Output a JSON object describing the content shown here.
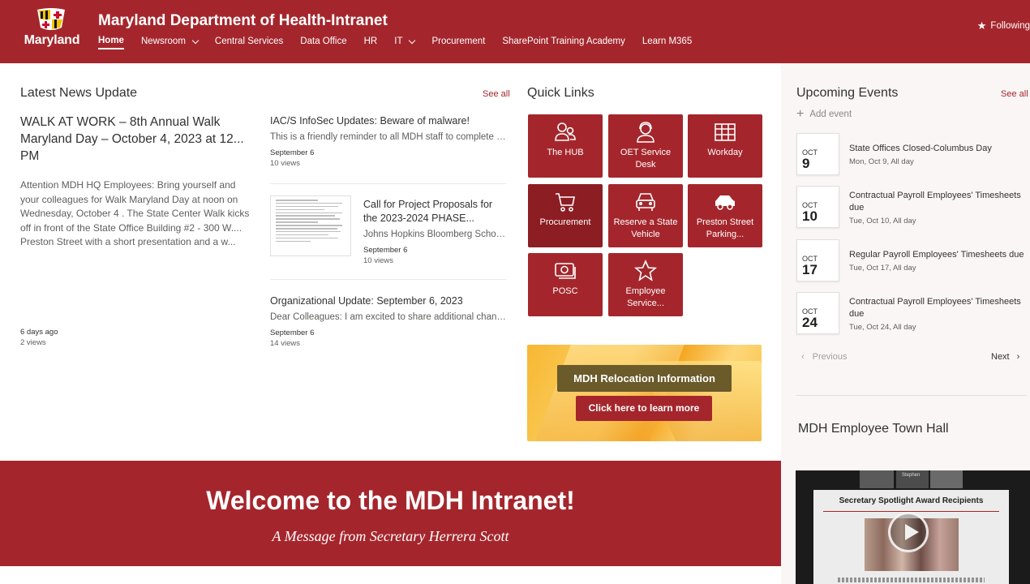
{
  "header": {
    "logo_text": "Maryland",
    "site_title": "Maryland Department of Health-Intranet",
    "following_label": "Following",
    "nav": [
      {
        "label": "Home"
      },
      {
        "label": "Newsroom"
      },
      {
        "label": "Central Services"
      },
      {
        "label": "Data Office"
      },
      {
        "label": "HR"
      },
      {
        "label": "IT"
      },
      {
        "label": "Procurement"
      },
      {
        "label": "SharePoint Training Academy"
      },
      {
        "label": "Learn M365"
      }
    ]
  },
  "news": {
    "title": "Latest News Update",
    "see_all": "See all",
    "featured": {
      "title": "WALK AT WORK – 8th Annual Walk Maryland Day – October 4, 2023 at 12... PM",
      "description": "Attention MDH HQ Employees: Bring yourself and your colleagues for Walk Maryland Day at noon on Wednesday, October 4 . The State Center Walk kicks off in front of the State Office Building #2 - 300 W.... Preston Street with a short presentation and a w...",
      "date": "6 days ago",
      "views": "2 views"
    },
    "items": [
      {
        "title": "IAC/S InfoSec Updates: Beware of malware!",
        "description": "This is a friendly reminder to all MDH staff to complete you...",
        "date": "September 6",
        "views": "10 views"
      },
      {
        "title": "Call for Project Proposals for the 2023-2024 PHASE...",
        "description": "Johns Hopkins Bloomberg School ...",
        "date": "September 6",
        "views": "10 views"
      },
      {
        "title": "Organizational Update: September 6, 2023",
        "description": "Dear Colleagues: I am excited to share additional changes i...",
        "date": "September 6",
        "views": "14 views"
      }
    ]
  },
  "quick_links": {
    "title": "Quick Links",
    "tiles": [
      {
        "label": "The HUB",
        "icon": "people-icon"
      },
      {
        "label": "OET Service Desk",
        "icon": "person-headset-icon"
      },
      {
        "label": "Workday",
        "icon": "table-grid-icon"
      },
      {
        "label": "Procurement",
        "icon": "cart-icon"
      },
      {
        "label": "Reserve a State Vehicle",
        "icon": "car-front-icon"
      },
      {
        "label": "Preston Street Parking...",
        "icon": "car-side-icon"
      },
      {
        "label": "POSC",
        "icon": "money-icon"
      },
      {
        "label": "Employee Service...",
        "icon": "star-icon"
      }
    ]
  },
  "banner": {
    "label": "MDH Relocation Information",
    "button": "Click here to learn more"
  },
  "events": {
    "title": "Upcoming Events",
    "see_all": "See all",
    "add_event": "Add event",
    "items": [
      {
        "month": "OCT",
        "day": "9",
        "name": "State Offices Closed-Columbus Day",
        "when": "Mon, Oct 9, All day"
      },
      {
        "month": "OCT",
        "day": "10",
        "name": "Contractual Payroll Employees' Timesheets due",
        "when": "Tue, Oct 10, All day"
      },
      {
        "month": "OCT",
        "day": "17",
        "name": "Regular Payroll Employees' Timesheets due",
        "when": "Tue, Oct 17, All day"
      },
      {
        "month": "OCT",
        "day": "24",
        "name": "Contractual Payroll Employees' Timesheets due",
        "when": "Tue, Oct 24, All day"
      }
    ],
    "previous": "Previous",
    "next": "Next"
  },
  "town_hall": {
    "title": "MDH Employee Town Hall",
    "camera_name": "Stephen",
    "slide_title": "Secretary Spotlight Award Recipients"
  },
  "welcome": {
    "title": "Welcome to the MDH Intranet!",
    "subtitle": "A Message from Secretary Herrera Scott"
  },
  "colors": {
    "brand": "#a4262c",
    "panel": "#faf6f6"
  }
}
